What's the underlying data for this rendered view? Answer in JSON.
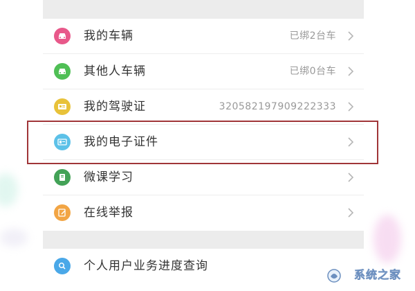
{
  "menu": {
    "items": [
      {
        "label": "我的车辆",
        "value": "已绑2台车",
        "icon": "car-icon",
        "color": "#e8588a"
      },
      {
        "label": "其他人车辆",
        "value": "已绑0台车",
        "icon": "car-icon",
        "color": "#4fbf55"
      },
      {
        "label": "我的驾驶证",
        "value": "320582197909222333",
        "icon": "license-card-icon",
        "color": "#e8c23a"
      },
      {
        "label": "我的电子证件",
        "value": "",
        "icon": "id-card-icon",
        "color": "#5cc1e8"
      },
      {
        "label": "微课学习",
        "value": "",
        "icon": "book-icon",
        "color": "#43a257"
      },
      {
        "label": "在线举报",
        "value": "",
        "icon": "edit-icon",
        "color": "#f2a544"
      }
    ],
    "query_item": {
      "label": "个人用户业务进度查询",
      "icon": "search-icon",
      "color": "#4aa8e8"
    }
  },
  "watermark": {
    "text": "系统之家"
  },
  "colors": {
    "highlight_border": "#a03538",
    "section_gap": "#ececec"
  }
}
